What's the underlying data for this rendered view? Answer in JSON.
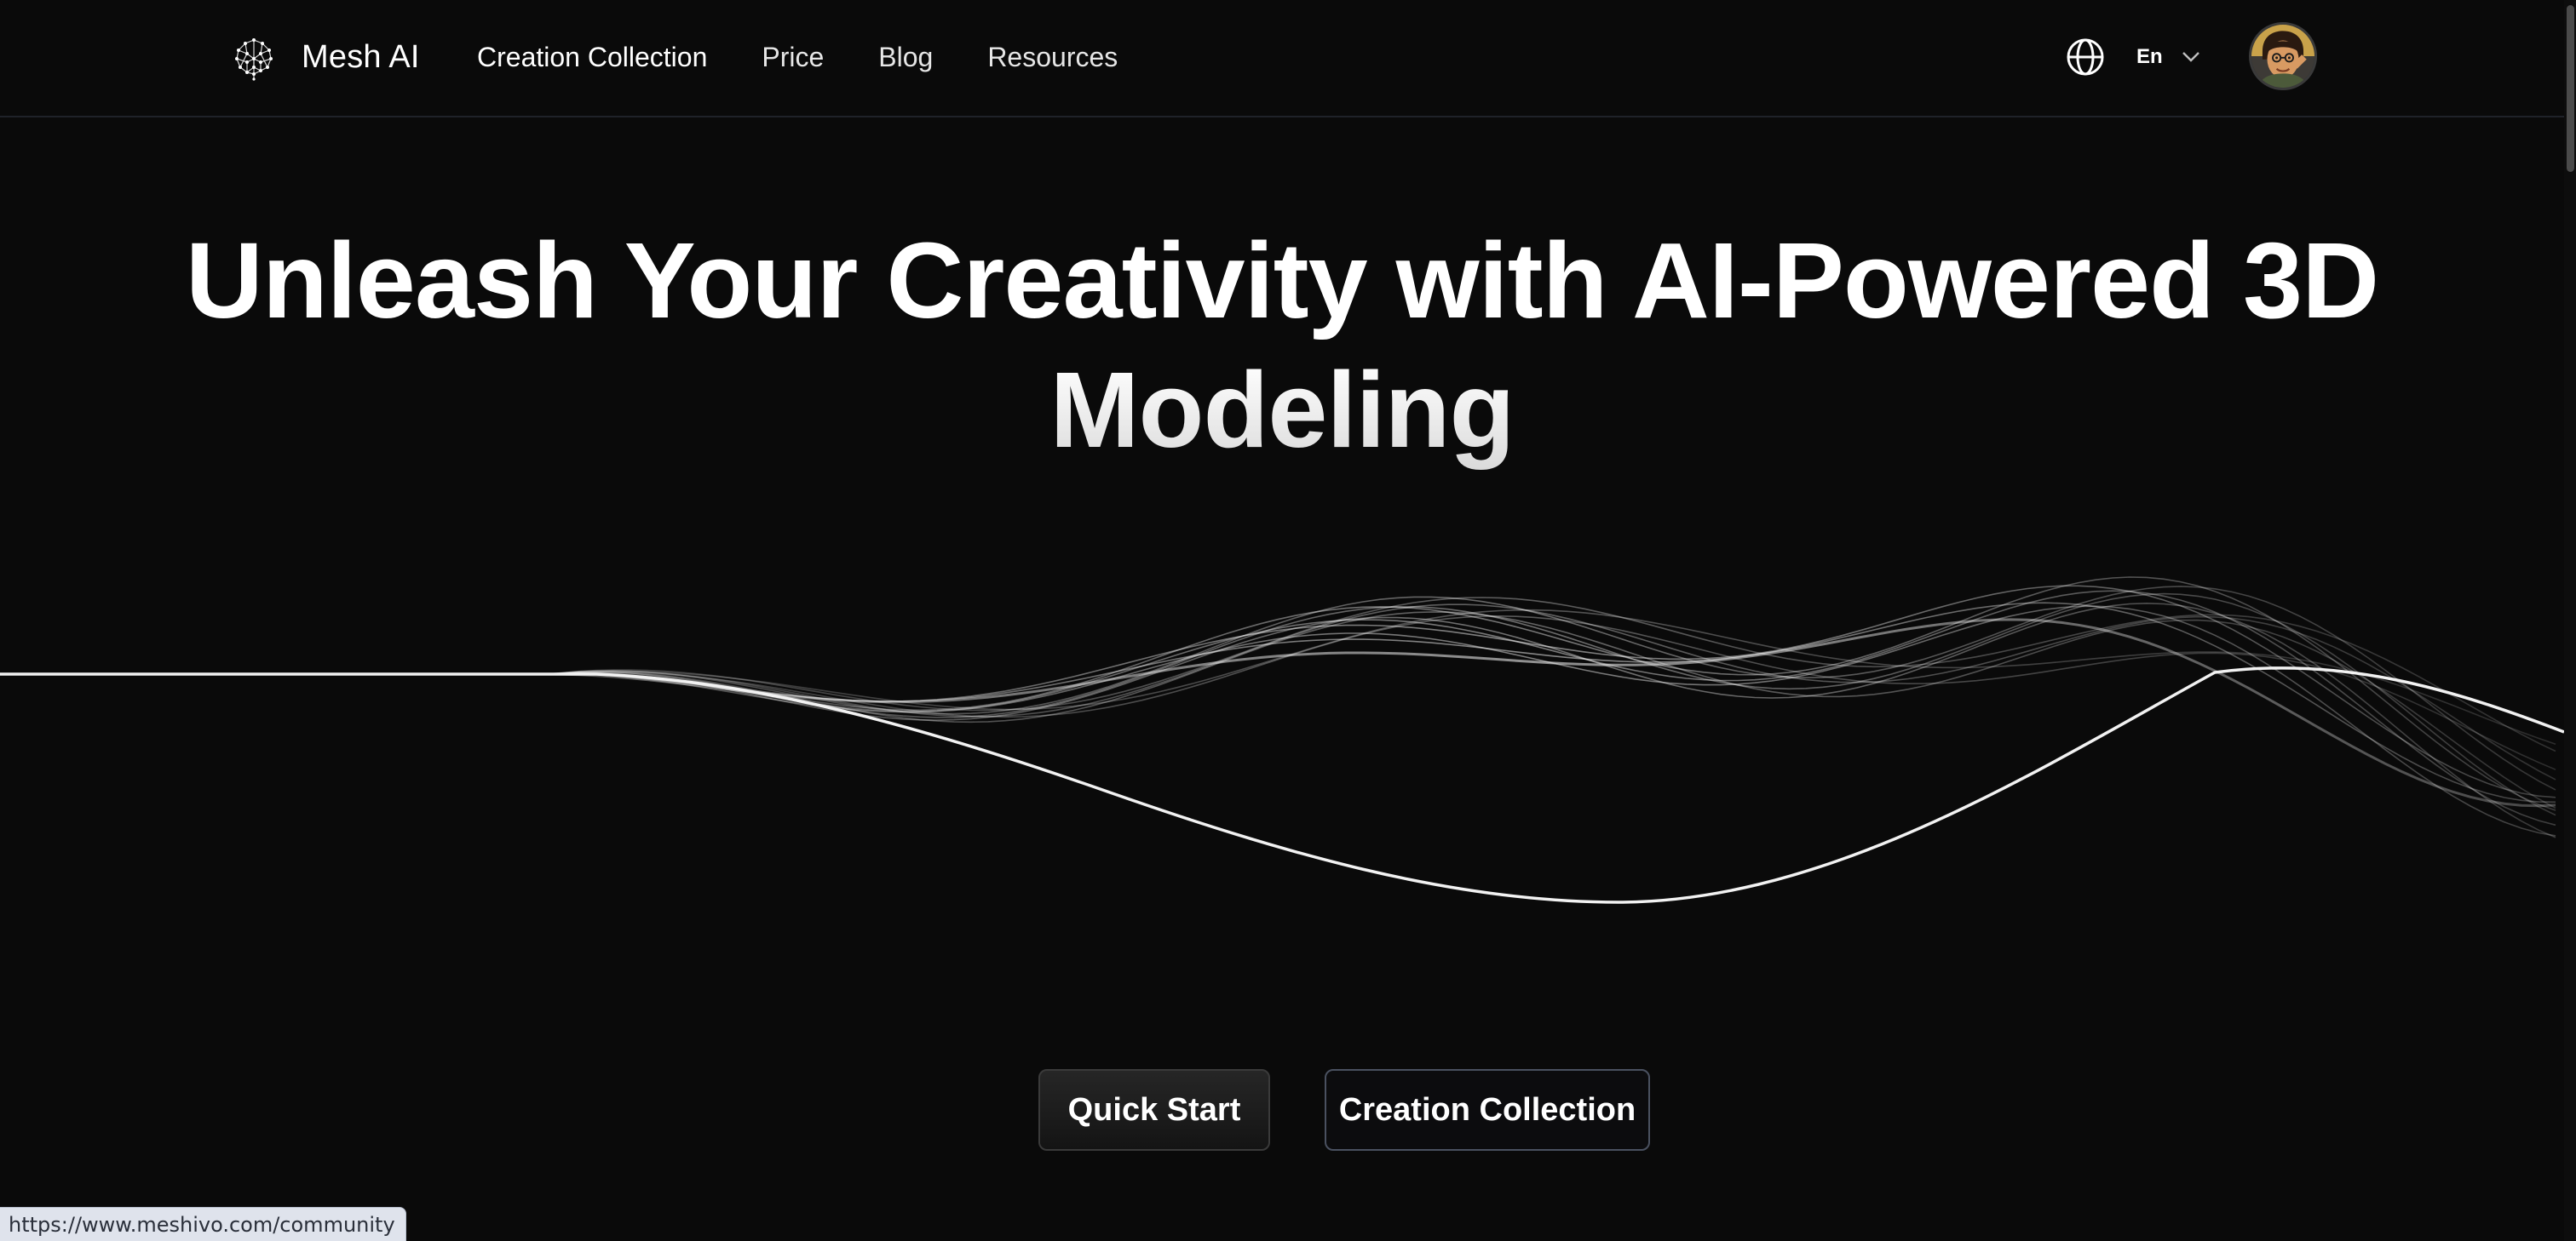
{
  "header": {
    "brand_name": "Mesh AI",
    "logo_icon": "brain-mesh-icon",
    "nav": [
      {
        "label": "Creation Collection",
        "active": true
      },
      {
        "label": "Price",
        "active": false
      },
      {
        "label": "Blog",
        "active": false
      },
      {
        "label": "Resources",
        "active": false
      }
    ],
    "language": {
      "icon": "globe-icon",
      "label": "En",
      "dropdown_icon": "chevron-down-icon"
    },
    "avatar": "user-avatar"
  },
  "hero": {
    "title": "Unleash Your Creativity with AI-Powered 3D Modeling",
    "decoration": "wave-lines"
  },
  "actions": {
    "primary_label": "Quick Start",
    "secondary_label": "Creation Collection"
  },
  "status_bar": {
    "url": "https://www.meshivo.com/community"
  },
  "colors": {
    "background": "#0a0a0a",
    "text": "#ffffff",
    "header_border": "#1f2229",
    "secondary_button_border": "#4a5160",
    "status_bar_bg": "#dfe3ec"
  }
}
